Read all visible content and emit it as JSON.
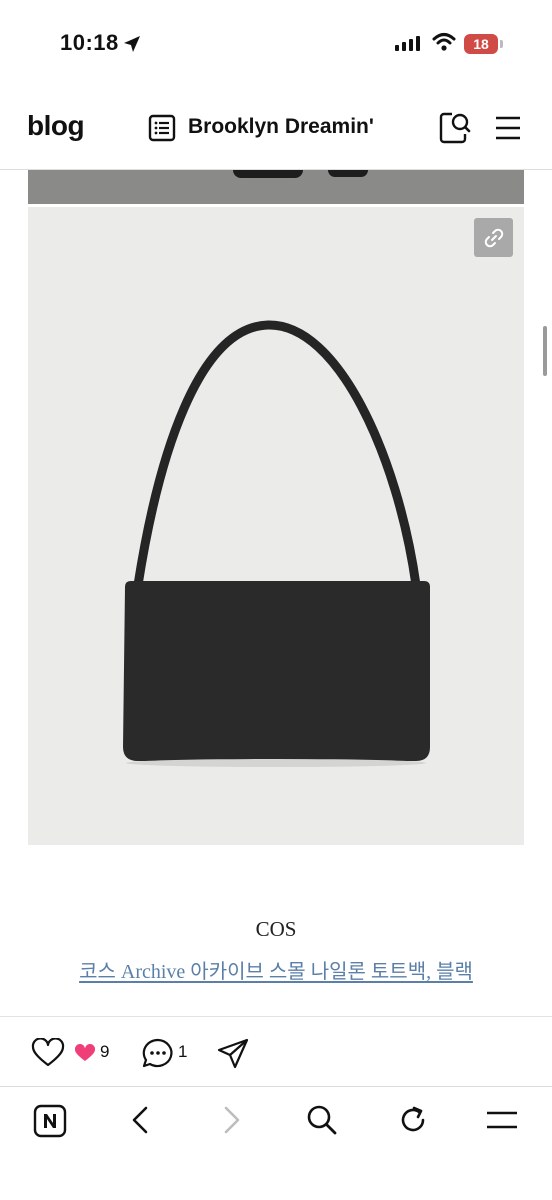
{
  "status_bar": {
    "time": "10:18",
    "battery": "18"
  },
  "header": {
    "logo": "blog",
    "blog_title": "Brooklyn Dreamin'"
  },
  "post": {
    "brand": "COS",
    "product_link": "코스 Archive 아카이브 스몰 나일론 토트백, 블랙"
  },
  "actions": {
    "like_count": "9",
    "comment_count": "1"
  },
  "icons": [
    "location-arrow-icon",
    "signal-icon",
    "wifi-icon",
    "battery-icon",
    "list-icon",
    "search-icon",
    "menu-icon",
    "link-icon",
    "heart-icon",
    "pink-heart-icon",
    "comment-icon",
    "share-icon",
    "naver-icon",
    "back-icon",
    "forward-icon",
    "reload-icon"
  ],
  "colors": {
    "link": "#5b7fa8",
    "battery": "#d14b46",
    "like_accent": "#ef3e78"
  }
}
